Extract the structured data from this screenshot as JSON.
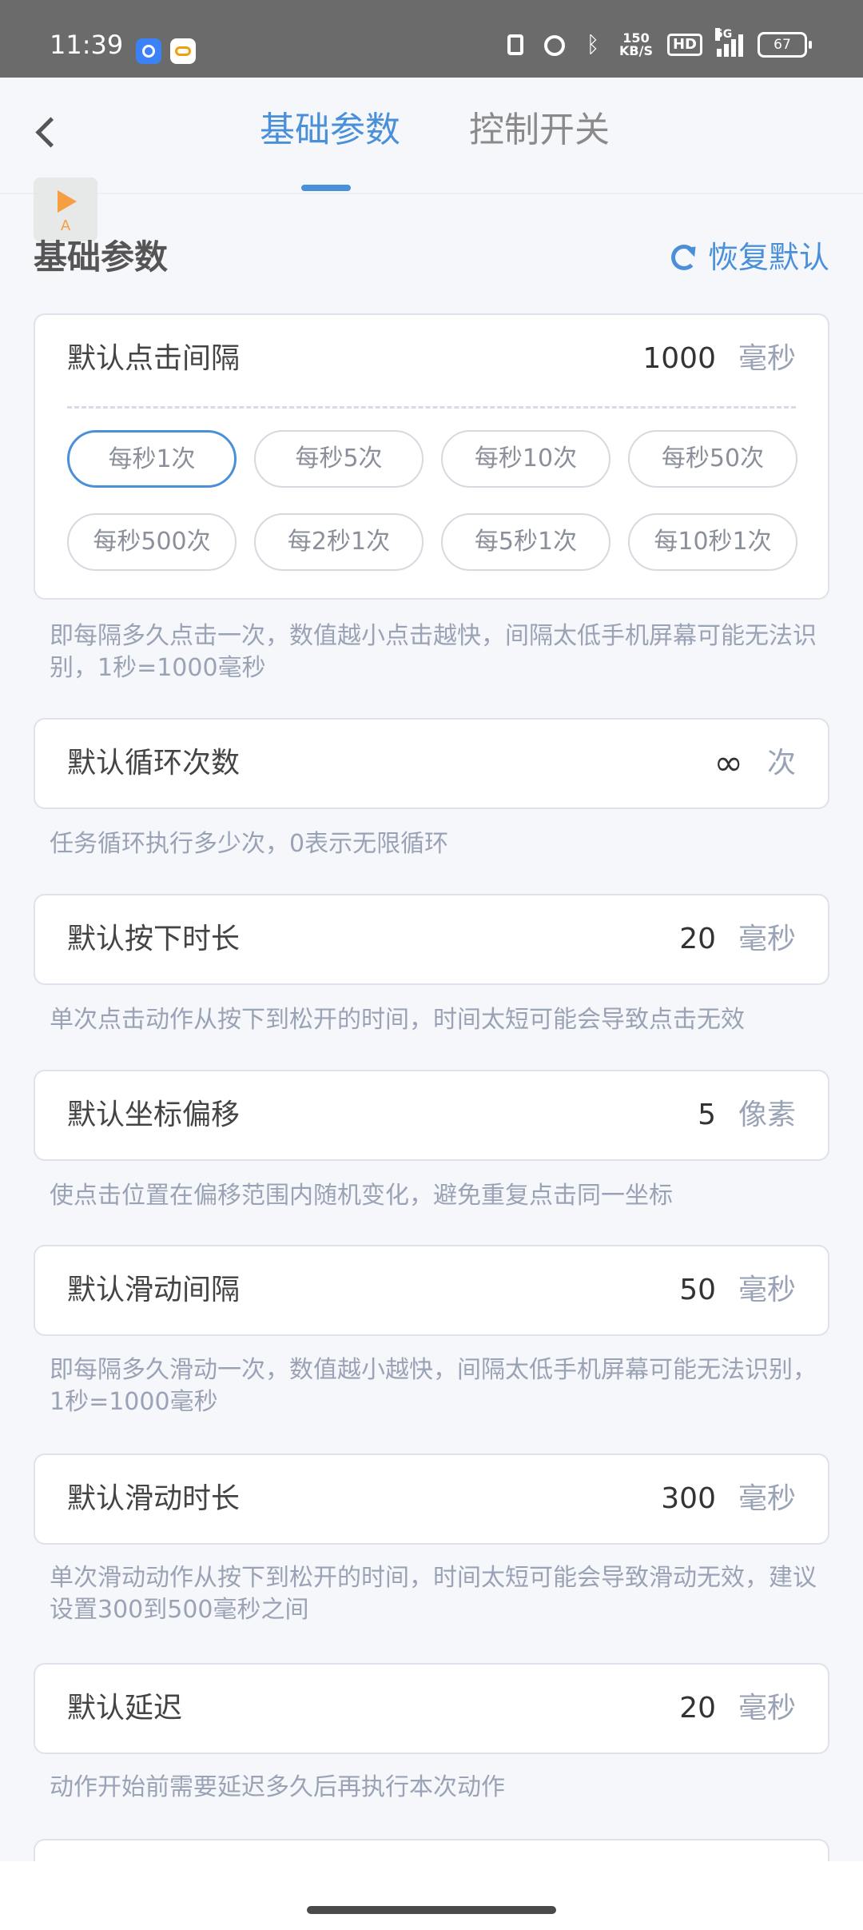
{
  "status_bar": {
    "time": "11:39",
    "speed_value": "150",
    "speed_unit": "KB/S",
    "hd": "HD",
    "network": "5G",
    "battery": "67"
  },
  "tabs": {
    "basic": "基础参数",
    "control": "控制开关"
  },
  "floating_widget": {
    "letter": "A"
  },
  "section": {
    "title": "基础参数",
    "restore_label": "恢复默认"
  },
  "click_interval": {
    "label": "默认点击间隔",
    "value": "1000",
    "unit": "毫秒",
    "presets": [
      "每秒1次",
      "每秒5次",
      "每秒10次",
      "每秒50次",
      "每秒500次",
      "每2秒1次",
      "每5秒1次",
      "每10秒1次"
    ],
    "selected_preset": "每秒1次",
    "description": "即每隔多久点击一次，数值越小点击越快，间隔太低手机屏幕可能无法识别，1秒=1000毫秒"
  },
  "loop_count": {
    "label": "默认循环次数",
    "value": "∞",
    "unit": "次",
    "description": "任务循环执行多少次，0表示无限循环"
  },
  "press_duration": {
    "label": "默认按下时长",
    "value": "20",
    "unit": "毫秒",
    "description": "单次点击动作从按下到松开的时间，时间太短可能会导致点击无效"
  },
  "coord_offset": {
    "label": "默认坐标偏移",
    "value": "5",
    "unit": "像素",
    "description": "使点击位置在偏移范围内随机变化，避免重复点击同一坐标"
  },
  "swipe_interval": {
    "label": "默认滑动间隔",
    "value": "50",
    "unit": "毫秒",
    "description": "即每隔多久滑动一次，数值越小越快，间隔太低手机屏幕可能无法识别，1秒=1000毫秒"
  },
  "swipe_duration": {
    "label": "默认滑动时长",
    "value": "300",
    "unit": "毫秒",
    "description": "单次滑动动作从按下到松开的时间，时间太短可能会导致滑动无效，建议设置300到500毫秒之间"
  },
  "delay": {
    "label": "默认延迟",
    "value": "20",
    "unit": "毫秒",
    "description": "动作开始前需要延迟多久后再执行本次动作"
  }
}
